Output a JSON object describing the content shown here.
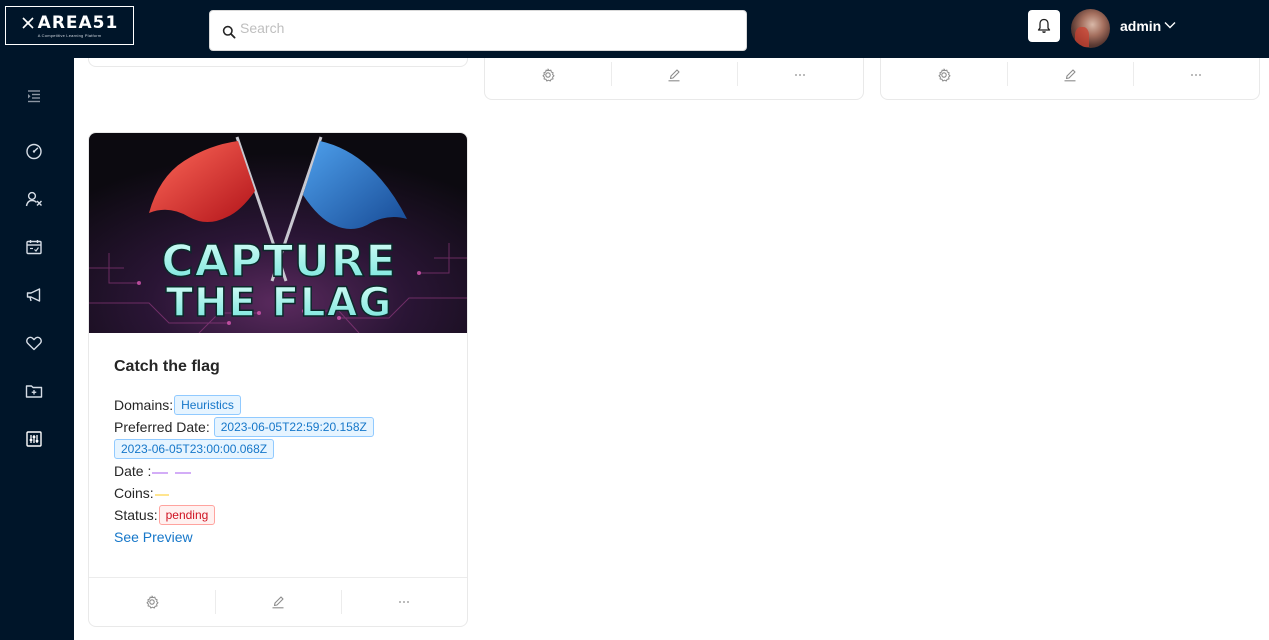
{
  "brand": {
    "name": "AREA51",
    "tagline": "A Competitive Learning Platform"
  },
  "search": {
    "placeholder": "Search",
    "value": ""
  },
  "user": {
    "name": "admin"
  },
  "sidebar": {
    "items": [
      {
        "icon": "menu-fold-icon"
      },
      {
        "icon": "dashboard-icon"
      },
      {
        "icon": "users-icon"
      },
      {
        "icon": "calendar-icon"
      },
      {
        "icon": "announcement-icon"
      },
      {
        "icon": "heart-icon"
      },
      {
        "icon": "folder-add-icon"
      },
      {
        "icon": "control-icon"
      }
    ]
  },
  "card": {
    "cover_title_line1": "CAPTURE",
    "cover_title_line2": "THE FLAG",
    "title": "Catch the flag",
    "domains_label": "Domains:",
    "domains": [
      "Heuristics"
    ],
    "preferred_date_label": "Preferred Date:",
    "preferred_dates": [
      "2023-06-05T22:59:20.158Z",
      "2023-06-05T23:00:00.068Z"
    ],
    "date_label": "Date :",
    "coins_label": "Coins:",
    "status_label": "Status:",
    "status": "pending",
    "preview_link": "See Preview"
  },
  "colors": {
    "header_bg": "#001529",
    "link": "#1677c9",
    "tag_blue": "#1677c9",
    "tag_red": "#cf1322"
  }
}
